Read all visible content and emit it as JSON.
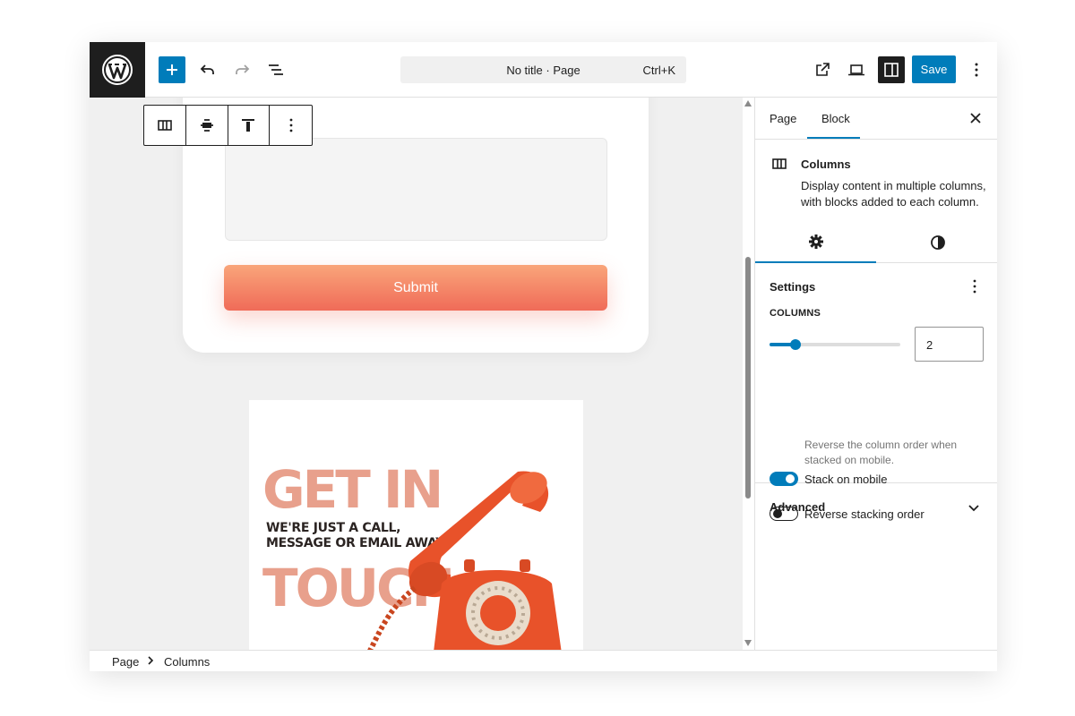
{
  "header": {
    "command_title": "No title · Page",
    "command_shortcut": "Ctrl+K",
    "save_label": "Save"
  },
  "canvas": {
    "submit_label": "Submit",
    "image": {
      "headline_line1": "GET IN",
      "headline_line2": "TOUCH",
      "tagline_line1": "WE'RE JUST A CALL,",
      "tagline_line2": "MESSAGE OR EMAIL AWAY."
    }
  },
  "sidebar": {
    "tabs": {
      "page": "Page",
      "block": "Block"
    },
    "block_card": {
      "title": "Columns",
      "description": "Display content in multiple columns, with blocks added to each column."
    },
    "settings_panel": {
      "title": "Settings",
      "columns_label": "Columns",
      "columns_value": "2",
      "columns_slider_fraction": 0.2,
      "stack_on_mobile_label": "Stack on mobile",
      "stack_on_mobile": true,
      "reverse_order_label": "Reverse stacking order",
      "reverse_order": false,
      "reverse_help": "Reverse the column order when stacked on mobile."
    },
    "advanced_label": "Advanced"
  },
  "breadcrumb": [
    "Page",
    "Columns"
  ],
  "colors": {
    "accent": "#007cba",
    "dark": "#1e1e1e",
    "submit_gradient_top": "#f9a57a",
    "submit_gradient_bottom": "#f06b58",
    "phone": "#e8522a"
  },
  "icons": [
    "wordpress-logo-icon",
    "plus-icon",
    "undo-icon",
    "redo-icon",
    "list-view-icon",
    "external-link-icon",
    "desktop-preview-icon",
    "sidebar-toggle-icon",
    "more-vertical-icon",
    "close-icon",
    "columns-icon",
    "gear-icon",
    "contrast-icon",
    "chevron-down-icon",
    "chevron-right-icon"
  ]
}
